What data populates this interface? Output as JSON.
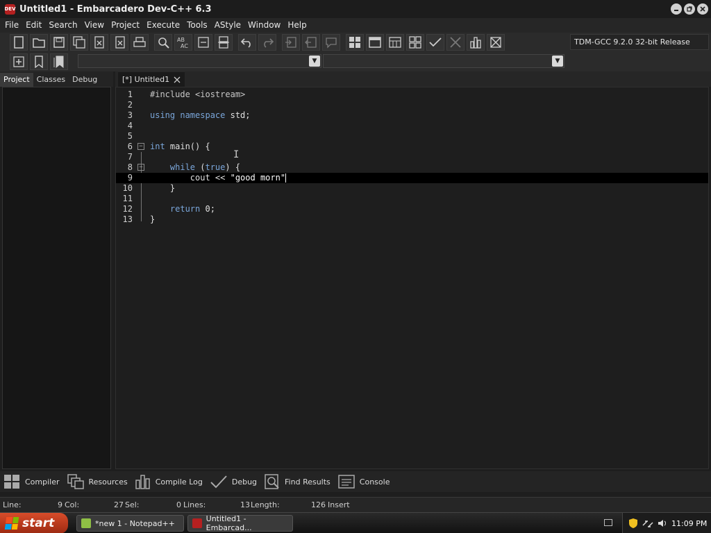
{
  "window": {
    "logo_text": "DEV",
    "title": "Untitled1 - Embarcadero Dev-C++ 6.3",
    "controls": [
      "minimize",
      "restore",
      "close"
    ]
  },
  "menu": [
    "File",
    "Edit",
    "Search",
    "View",
    "Project",
    "Execute",
    "Tools",
    "AStyle",
    "Window",
    "Help"
  ],
  "toolbar": {
    "compiler": "TDM-GCC 9.2.0 32-bit Release",
    "row1_icons": [
      "new-file-icon",
      "open-folder-icon",
      "save-icon",
      "save-all-icon",
      "close-file-icon",
      "close-all-icon",
      "print-icon",
      "find-icon",
      "replace-icon",
      "goto-line-icon",
      "split-icon",
      "undo-icon",
      "redo-icon",
      "indent-icon",
      "unindent-icon",
      "comment-icon",
      "compile-icon",
      "run-icon",
      "compile-run-icon",
      "rebuild-icon",
      "check-icon",
      "stop-icon",
      "chart-icon",
      "delete-icon"
    ],
    "row2_icons": [
      "add-project-icon",
      "bookmark-icon",
      "bookmarks-icon"
    ]
  },
  "left_panel": {
    "tabs": [
      "Project",
      "Classes",
      "Debug"
    ],
    "active_tab": "Project"
  },
  "editor": {
    "tab_label": "[*] Untitled1",
    "current_line": 9,
    "lines": [
      {
        "n": "1",
        "text": "#include <iostream>"
      },
      {
        "n": "2",
        "text": ""
      },
      {
        "n": "3",
        "kw": "using namespace",
        "rest": " std;"
      },
      {
        "n": "4",
        "text": ""
      },
      {
        "n": "5",
        "text": ""
      },
      {
        "n": "6",
        "kw": "int",
        "rest": " main() {"
      },
      {
        "n": "7",
        "text": ""
      },
      {
        "n": "8",
        "indent": "    ",
        "kw": "while",
        "rest": " (",
        "kw2": "true",
        "rest2": ") {"
      },
      {
        "n": "9",
        "indent": "        ",
        "pre": "cout << ",
        "str": "\"good morn\""
      },
      {
        "n": "10",
        "text": "    }"
      },
      {
        "n": "11",
        "text": ""
      },
      {
        "n": "12",
        "indent": "    ",
        "kw": "return",
        "rest": " 0;"
      },
      {
        "n": "13",
        "text": "}"
      }
    ]
  },
  "bottom_tabs": [
    {
      "label": "Compiler",
      "icon": "compiler-grid-icon"
    },
    {
      "label": "Resources",
      "icon": "resources-icon"
    },
    {
      "label": "Compile Log",
      "icon": "compile-log-icon"
    },
    {
      "label": "Debug",
      "icon": "debug-check-icon"
    },
    {
      "label": "Find Results",
      "icon": "find-results-icon"
    },
    {
      "label": "Console",
      "icon": "console-icon"
    }
  ],
  "status": {
    "line_label": "Line:",
    "line_value": "9",
    "col_label": "Col:",
    "col_value": "27",
    "sel_label": "Sel:",
    "sel_value": "0",
    "lines_label": "Lines:",
    "lines_value": "13",
    "length_label": "Length:",
    "length_value": "126",
    "mode": "Insert"
  },
  "taskbar": {
    "start_label": "start",
    "tasks": [
      {
        "label": "*new 1 - Notepad++",
        "color": "#8fbf45"
      },
      {
        "label": "Untitled1 - Embarcad...",
        "color": "#b52020"
      }
    ],
    "clock": "11:09 PM"
  },
  "colors": {
    "keyword": "#7aa6da",
    "background": "#1e1e1e",
    "current_line": "#000000",
    "start_button": "#c43d1f"
  }
}
